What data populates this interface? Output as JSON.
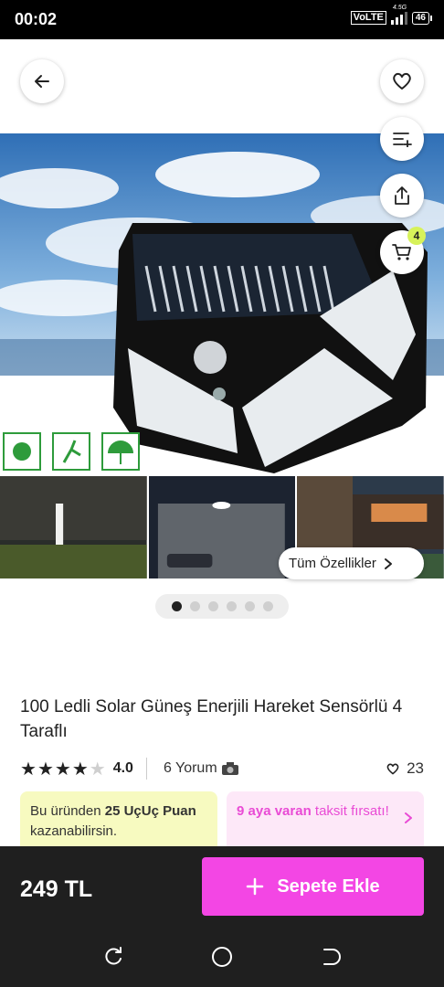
{
  "status_bar": {
    "time": "00:02",
    "volte": "VoLTE",
    "network": "4.5G",
    "battery": "46"
  },
  "header": {
    "back_icon": "arrow-left-icon",
    "favorite_icon": "heart-icon",
    "compare_icon": "list-plus-icon",
    "share_icon": "share-icon",
    "cart_icon": "cart-icon",
    "cart_count": "4"
  },
  "gallery": {
    "features_label": "Tüm Özellikler",
    "page_count": 6,
    "active_page": 1
  },
  "product": {
    "title": "100 Ledli Solar Güneş Enerjili Hareket Sensörlü 4 Taraflı",
    "rating": 4,
    "rating_text": "4.0",
    "reviews_text": "6 Yorum",
    "likes": "23"
  },
  "promo": {
    "points_prefix": "Bu üründen ",
    "points_bold": "25 UçUç Puan",
    "points_suffix": " kazanabilirsin.",
    "installment_bold": "9 aya varan",
    "installment_suffix": " taksit fırsatı!"
  },
  "bottom": {
    "price": "249 TL",
    "add_to_cart": "Sepete Ekle"
  },
  "colors": {
    "accent_pink": "#f346e4",
    "badge_yellow": "#d7f25a",
    "promo_yellow": "#f7fac0",
    "promo_pink": "#fde8f8"
  }
}
